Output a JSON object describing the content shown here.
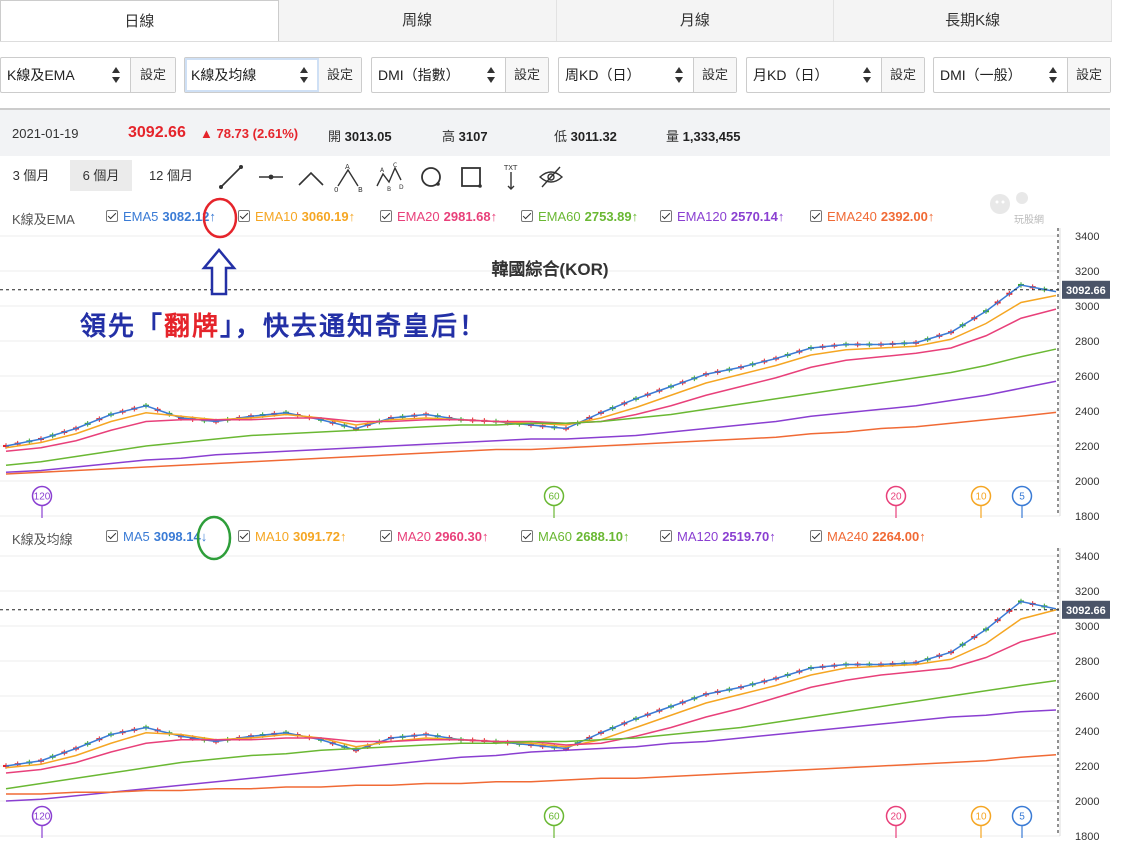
{
  "tabs": [
    "日線",
    "周線",
    "月線",
    "長期K線"
  ],
  "selectors": [
    {
      "label": "K線及EMA",
      "button": "設定"
    },
    {
      "label": "K線及均線",
      "button": "設定"
    },
    {
      "label": "DMI（指數）",
      "button": "設定"
    },
    {
      "label": "周KD（日）",
      "button": "設定"
    },
    {
      "label": "月KD（日）",
      "button": "設定"
    },
    {
      "label": "DMI（一般）",
      "button": "設定"
    }
  ],
  "quote": {
    "date": "2021-01-19",
    "price": "3092.66",
    "change": "▲ 78.73 (2.61%)",
    "open_label": "開",
    "open": "3013.05",
    "high_label": "高",
    "high": "3107",
    "low_label": "低",
    "low": "3011.32",
    "vol_label": "量",
    "volume": "1,333,455"
  },
  "periods": [
    "3 個月",
    "6 個月",
    "12 個月"
  ],
  "tool_icons": [
    "trend-line-icon",
    "horizontal-line-icon",
    "angle-line-icon",
    "abc-pattern-icon",
    "abcd-pattern-icon",
    "circle-icon",
    "rectangle-icon",
    "text-annotation-icon",
    "hide-drawings-icon"
  ],
  "colors": {
    "up": "#e5242b",
    "down": "#3aa830",
    "ma5": "#3a7bd5",
    "ma10": "#f5a623",
    "ma20": "#e8407a",
    "ma60": "#6ab833",
    "ma120": "#8a3fd1",
    "ma240": "#f06a35"
  },
  "ema_legend": {
    "title": "K線及EMA",
    "items": [
      {
        "name": "EMA5",
        "value": "3082.12",
        "arrow": "↑",
        "color": "#3a7bd5"
      },
      {
        "name": "EMA10",
        "value": "3060.19",
        "arrow": "↑",
        "color": "#f5a623"
      },
      {
        "name": "EMA20",
        "value": "2981.68",
        "arrow": "↑",
        "color": "#e8407a"
      },
      {
        "name": "EMA60",
        "value": "2753.89",
        "arrow": "↑",
        "color": "#6ab833"
      },
      {
        "name": "EMA120",
        "value": "2570.14",
        "arrow": "↑",
        "color": "#8a3fd1"
      },
      {
        "name": "EMA240",
        "value": "2392.00",
        "arrow": "↑",
        "color": "#f06a35"
      }
    ]
  },
  "ma_legend": {
    "title": "K線及均線",
    "items": [
      {
        "name": "MA5",
        "value": "3098.14",
        "arrow": "↓",
        "color": "#3a7bd5"
      },
      {
        "name": "MA10",
        "value": "3091.72",
        "arrow": "↑",
        "color": "#f5a623"
      },
      {
        "name": "MA20",
        "value": "2960.30",
        "arrow": "↑",
        "color": "#e8407a"
      },
      {
        "name": "MA60",
        "value": "2688.10",
        "arrow": "↑",
        "color": "#6ab833"
      },
      {
        "name": "MA120",
        "value": "2519.70",
        "arrow": "↑",
        "color": "#8a3fd1"
      },
      {
        "name": "MA240",
        "value": "2264.00",
        "arrow": "↑",
        "color": "#f06a35"
      }
    ]
  },
  "chart_title": "韓國綜合(KOR)",
  "price_tag": "3092.66",
  "y_ticks": [
    3400,
    3200,
    3000,
    2800,
    2600,
    2400,
    2200,
    2000,
    1800
  ],
  "period_markers": [
    {
      "label": "120",
      "color": "#8a3fd1"
    },
    {
      "label": "60",
      "color": "#6ab833"
    },
    {
      "label": "20",
      "color": "#e8407a"
    },
    {
      "label": "10",
      "color": "#f5a623"
    },
    {
      "label": "5",
      "color": "#3a7bd5"
    }
  ],
  "annotation": {
    "pre": "領先「",
    "red": "翻牌",
    "post": "」，快去通知奇皇后！"
  },
  "watermark": "玩股網",
  "chart_data": [
    {
      "type": "line",
      "ylim": [
        1800,
        3400
      ],
      "series": [
        {
          "name": "EMA5",
          "values": [
            2200,
            2240,
            2300,
            2380,
            2430,
            2360,
            2340,
            2370,
            2390,
            2350,
            2300,
            2360,
            2380,
            2350,
            2340,
            2320,
            2300,
            2390,
            2470,
            2540,
            2610,
            2650,
            2700,
            2760,
            2780,
            2780,
            2790,
            2850,
            2970,
            3120,
            3082
          ]
        },
        {
          "name": "EMA10",
          "values": [
            2190,
            2220,
            2270,
            2340,
            2390,
            2370,
            2350,
            2360,
            2380,
            2360,
            2320,
            2350,
            2360,
            2350,
            2340,
            2330,
            2320,
            2360,
            2420,
            2490,
            2560,
            2610,
            2660,
            2720,
            2750,
            2760,
            2770,
            2810,
            2900,
            3020,
            3060
          ]
        },
        {
          "name": "EMA20",
          "values": [
            2170,
            2190,
            2230,
            2290,
            2340,
            2350,
            2350,
            2350,
            2360,
            2360,
            2340,
            2340,
            2350,
            2350,
            2340,
            2340,
            2330,
            2340,
            2380,
            2430,
            2490,
            2540,
            2590,
            2650,
            2690,
            2710,
            2730,
            2760,
            2830,
            2930,
            2982
          ]
        },
        {
          "name": "EMA60",
          "values": [
            2090,
            2110,
            2140,
            2170,
            2200,
            2220,
            2240,
            2260,
            2270,
            2280,
            2290,
            2300,
            2310,
            2320,
            2320,
            2330,
            2330,
            2340,
            2360,
            2380,
            2410,
            2440,
            2470,
            2500,
            2530,
            2560,
            2590,
            2620,
            2660,
            2710,
            2754
          ]
        },
        {
          "name": "EMA120",
          "values": [
            2050,
            2060,
            2080,
            2100,
            2120,
            2130,
            2150,
            2160,
            2170,
            2180,
            2190,
            2200,
            2210,
            2220,
            2230,
            2240,
            2240,
            2250,
            2260,
            2280,
            2300,
            2320,
            2340,
            2370,
            2390,
            2410,
            2430,
            2460,
            2490,
            2530,
            2570
          ]
        },
        {
          "name": "EMA240",
          "values": [
            2040,
            2050,
            2060,
            2070,
            2080,
            2090,
            2100,
            2110,
            2120,
            2130,
            2140,
            2150,
            2160,
            2170,
            2180,
            2180,
            2190,
            2200,
            2210,
            2220,
            2230,
            2240,
            2250,
            2270,
            2280,
            2300,
            2310,
            2330,
            2350,
            2370,
            2392
          ]
        }
      ]
    },
    {
      "type": "line",
      "ylim": [
        1800,
        3400
      ],
      "series": [
        {
          "name": "MA5",
          "values": [
            2200,
            2230,
            2300,
            2380,
            2420,
            2370,
            2340,
            2370,
            2390,
            2350,
            2290,
            2360,
            2380,
            2350,
            2340,
            2320,
            2300,
            2390,
            2470,
            2540,
            2610,
            2650,
            2700,
            2760,
            2780,
            2780,
            2790,
            2850,
            2980,
            3140,
            3098
          ]
        },
        {
          "name": "MA10",
          "values": [
            2190,
            2210,
            2260,
            2330,
            2390,
            2380,
            2350,
            2360,
            2380,
            2360,
            2310,
            2340,
            2360,
            2350,
            2340,
            2330,
            2310,
            2350,
            2420,
            2490,
            2560,
            2610,
            2660,
            2720,
            2760,
            2770,
            2780,
            2810,
            2900,
            3040,
            3092
          ]
        },
        {
          "name": "MA20",
          "values": [
            2160,
            2180,
            2220,
            2280,
            2330,
            2350,
            2350,
            2350,
            2360,
            2360,
            2340,
            2340,
            2350,
            2350,
            2340,
            2340,
            2320,
            2330,
            2370,
            2420,
            2480,
            2530,
            2590,
            2650,
            2690,
            2720,
            2740,
            2760,
            2820,
            2910,
            2960
          ]
        },
        {
          "name": "MA60",
          "values": [
            2070,
            2100,
            2130,
            2160,
            2190,
            2220,
            2240,
            2260,
            2270,
            2290,
            2300,
            2310,
            2320,
            2330,
            2330,
            2340,
            2340,
            2350,
            2360,
            2380,
            2400,
            2420,
            2450,
            2480,
            2510,
            2540,
            2570,
            2600,
            2630,
            2660,
            2688
          ]
        },
        {
          "name": "MA120",
          "values": [
            2000,
            2010,
            2030,
            2050,
            2070,
            2090,
            2110,
            2130,
            2150,
            2170,
            2190,
            2210,
            2230,
            2250,
            2260,
            2280,
            2290,
            2300,
            2310,
            2330,
            2340,
            2360,
            2380,
            2400,
            2420,
            2440,
            2460,
            2480,
            2490,
            2510,
            2520
          ]
        },
        {
          "name": "MA240",
          "values": [
            2040,
            2040,
            2050,
            2050,
            2060,
            2060,
            2070,
            2070,
            2080,
            2080,
            2090,
            2090,
            2100,
            2100,
            2110,
            2110,
            2120,
            2130,
            2130,
            2140,
            2150,
            2160,
            2170,
            2180,
            2190,
            2200,
            2210,
            2220,
            2230,
            2250,
            2264
          ]
        }
      ]
    }
  ]
}
